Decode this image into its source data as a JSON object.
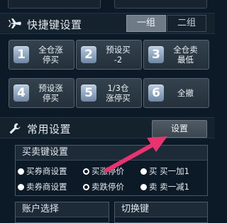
{
  "shortcut_section": {
    "title": "快捷键设置",
    "icon": "airplane-icon",
    "groups": [
      {
        "label": "一组",
        "active": true
      },
      {
        "label": "二组",
        "active": false
      }
    ]
  },
  "hotkeys": [
    {
      "num": "1",
      "label": "全仓涨\n停买"
    },
    {
      "num": "2",
      "label": "预设买\n-2"
    },
    {
      "num": "3",
      "label": "全仓卖\n最低"
    },
    {
      "num": "4",
      "label": "预设涨\n停买"
    },
    {
      "num": "5",
      "label": "1/3仓\n涨停买"
    },
    {
      "num": "6",
      "label": "全撤"
    }
  ],
  "common_section": {
    "title": "常用设置",
    "icon": "wrench-icon",
    "settings_button": "设置"
  },
  "trade_key_panel": {
    "title": "买卖键设置",
    "options": [
      {
        "label": "买券商设置",
        "checked": false
      },
      {
        "label": "买涨停价",
        "checked": true
      },
      {
        "label": "买 买一加1",
        "checked": false
      },
      {
        "label": "卖券商设置",
        "checked": false
      },
      {
        "label": "卖跌停价",
        "checked": true
      },
      {
        "label": "卖 卖一减1",
        "checked": false
      }
    ]
  },
  "bottom_panels": {
    "account": "账户选择",
    "switch_key": "切换键"
  },
  "colors": {
    "background": "#0c1a28",
    "arrow": "#e8336f"
  }
}
